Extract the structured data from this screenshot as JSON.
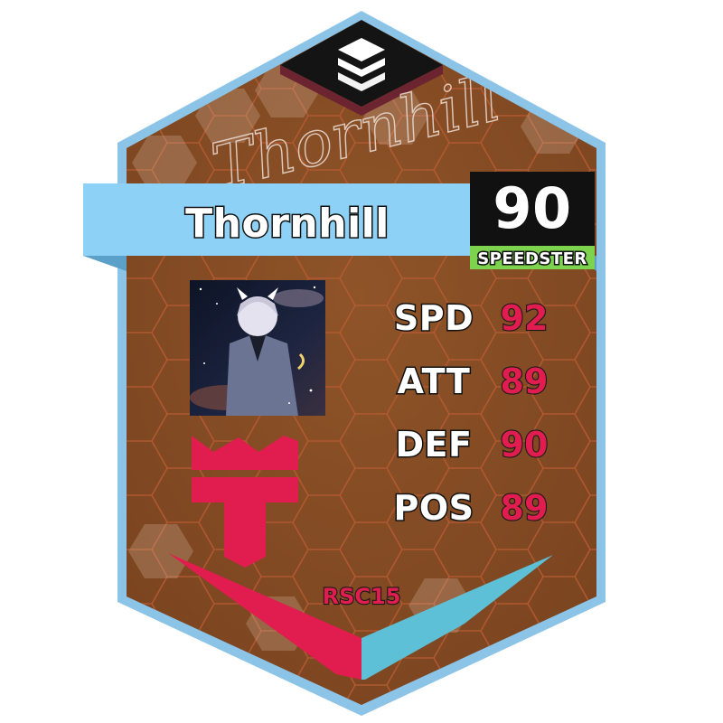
{
  "player": {
    "name": "Thornhill",
    "signature": "Thornhill",
    "rating": "90",
    "role": "SPEEDSTER",
    "league_code": "RSC15"
  },
  "stats": [
    {
      "label": "SPD",
      "value": "92"
    },
    {
      "label": "ATT",
      "value": "89"
    },
    {
      "label": "DEF",
      "value": "90"
    },
    {
      "label": "POS",
      "value": "89"
    }
  ],
  "icons": {
    "top_emblem": "layered-chevron-logo-icon",
    "team_logo": "crowned-t-team-logo-icon",
    "avatar": "anime-character-avatar"
  },
  "colors": {
    "card_fill": "#8e5226",
    "card_border": "#8cc4e8",
    "name_banner": "#8dd2f6",
    "rating_box": "#111111",
    "role_badge": "#7ed34e",
    "accent_red": "#e01d4e",
    "accent_teal": "#5ec0d6"
  }
}
